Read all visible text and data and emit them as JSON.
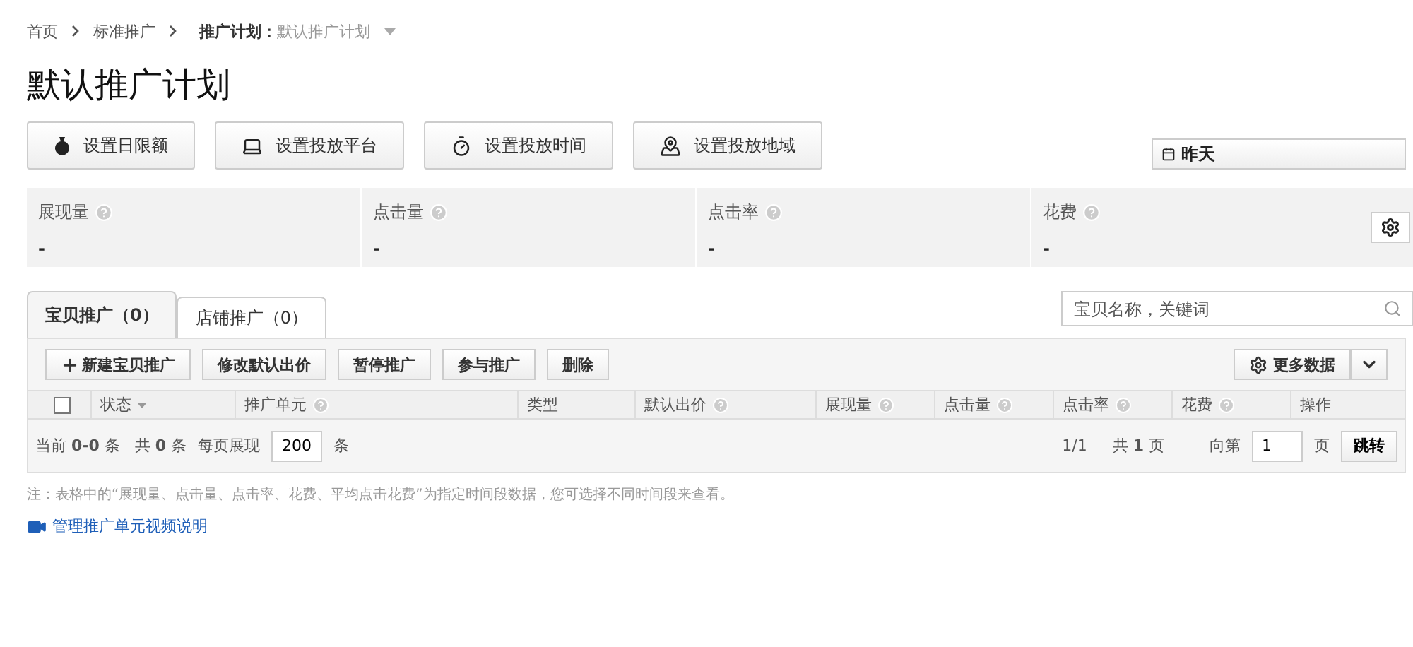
{
  "breadcrumb": {
    "items": [
      {
        "label": "首页"
      },
      {
        "label": "标准推广"
      }
    ],
    "current_label": "推广计划：",
    "current_value": "默认推广计划"
  },
  "title": "默认推广计划",
  "actions": [
    {
      "kind": "budget",
      "label": "设置日限额"
    },
    {
      "kind": "platform",
      "label": "设置投放平台"
    },
    {
      "kind": "time",
      "label": "设置投放时间"
    },
    {
      "kind": "region",
      "label": "设置投放地域"
    }
  ],
  "date_range": {
    "value": "昨天"
  },
  "stats": [
    {
      "label": "展现量",
      "value": "-",
      "help": true
    },
    {
      "label": "点击量",
      "value": "-",
      "help": true
    },
    {
      "label": "点击率",
      "value": "-",
      "help": true
    },
    {
      "label": "花费",
      "value": "-",
      "help": true
    }
  ],
  "tabs": [
    {
      "label": "宝贝推广（0）",
      "selected": true
    },
    {
      "label": "店铺推广（0）",
      "selected": false
    }
  ],
  "search": {
    "placeholder": "宝贝名称，关键词"
  },
  "toolbar": [
    {
      "label": "新建宝贝推广",
      "kind": "add"
    },
    {
      "label": "修改默认出价",
      "kind": "plain"
    },
    {
      "label": "暂停推广",
      "kind": "plain"
    },
    {
      "label": "参与推广",
      "kind": "plain"
    },
    {
      "label": "删除",
      "kind": "plain"
    }
  ],
  "more_data": {
    "label": "更多数据"
  },
  "table": {
    "all_checked": false,
    "columns": [
      {
        "label": "状态",
        "help": false,
        "sortable": true
      },
      {
        "label": "推广单元",
        "help": true,
        "sortable": false
      },
      {
        "label": "类型",
        "help": false,
        "sortable": false
      },
      {
        "label": "默认出价",
        "help": true,
        "sortable": false
      },
      {
        "label": "展现量",
        "help": true,
        "sortable": false
      },
      {
        "label": "点击量",
        "help": true,
        "sortable": false
      },
      {
        "label": "点击率",
        "help": true,
        "sortable": false
      },
      {
        "label": "花费",
        "help": true,
        "sortable": false
      },
      {
        "label": "操作",
        "help": false,
        "sortable": false
      }
    ]
  },
  "pagination": {
    "summary": "当前 **0-0** 条   共 **0** 条",
    "per_page_label": "每页展现",
    "per_page": "200",
    "per_page_unit": "条",
    "page_info": "1/1",
    "total_pages": "共 **1** 页",
    "goto_label": "向第",
    "goto_value": "1",
    "goto_unit": "页",
    "goto_button": "跳转"
  },
  "note": "注：表格中的“展现量、点击量、点击率、花费、平均点击花费”为指定时间段数据，您可选择不同时间段来查看。",
  "video_link": "管理推广单元视频说明"
}
